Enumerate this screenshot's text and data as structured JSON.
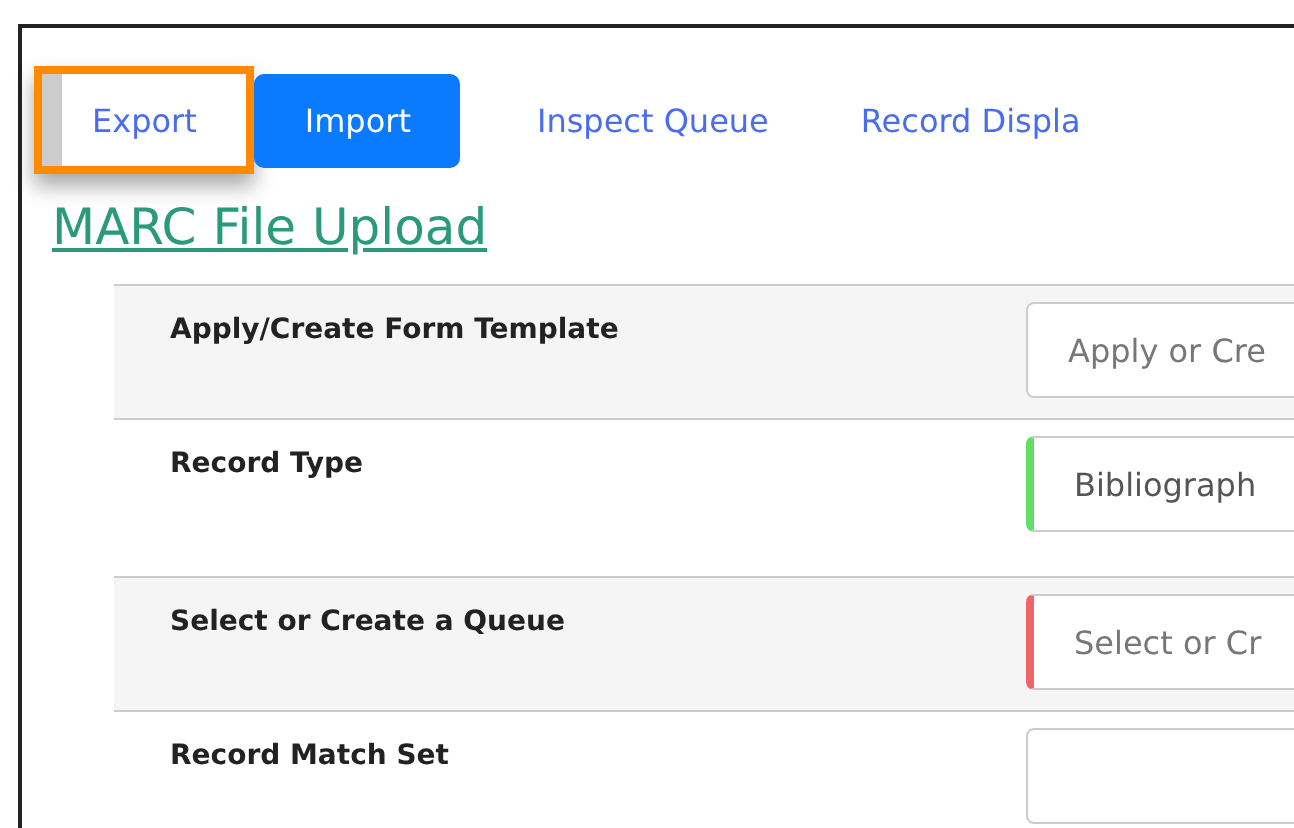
{
  "tabs": [
    {
      "label": "Export",
      "selected": false,
      "highlighted": true
    },
    {
      "label": "Import",
      "selected": true,
      "highlighted": false
    },
    {
      "label": "Inspect Queue",
      "selected": false,
      "highlighted": false
    },
    {
      "label": "Record Displa",
      "selected": false,
      "highlighted": false
    }
  ],
  "heading": "MARC File Upload",
  "rows": [
    {
      "label": "Apply/Create Form Template",
      "placeholder": "Apply or Cre"
    },
    {
      "label": "Record Type",
      "value": "Bibliograph",
      "color": "#66dd66"
    },
    {
      "label": "Select or Create a Queue",
      "placeholder": "Select or Cr",
      "color": "#ee6666"
    },
    {
      "label": "Record Match Set"
    }
  ]
}
